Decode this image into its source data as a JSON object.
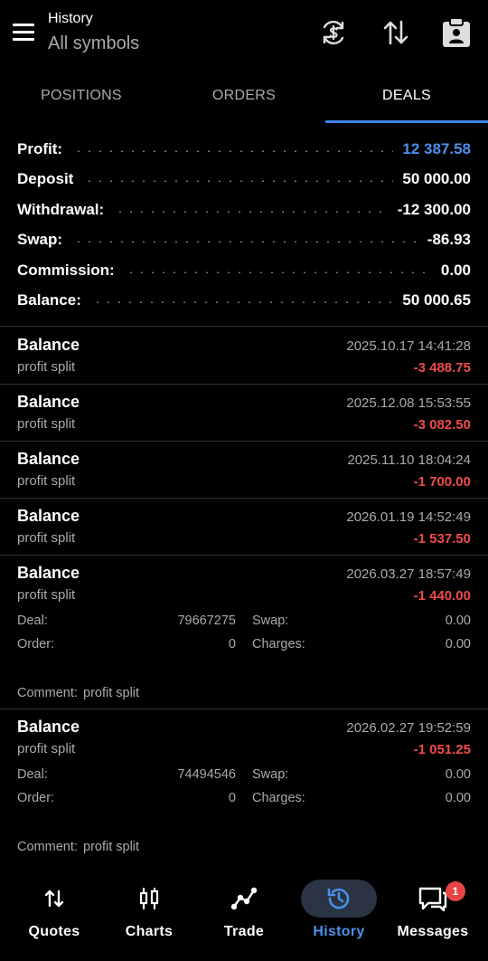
{
  "header": {
    "title": "History",
    "subtitle": "All symbols",
    "icons": [
      "menu-icon",
      "sync-currency-icon",
      "sort-icon",
      "clipboard-user-icon"
    ]
  },
  "tabs": [
    {
      "label": "POSITIONS",
      "active": false
    },
    {
      "label": "ORDERS",
      "active": false
    },
    {
      "label": "DEALS",
      "active": true
    }
  ],
  "summary": [
    {
      "label": "Profit:",
      "value": "12 387.58",
      "accent": "#4a90ea"
    },
    {
      "label": "Deposit",
      "value": "50 000.00"
    },
    {
      "label": "Withdrawal:",
      "value": "-12 300.00"
    },
    {
      "label": "Swap:",
      "value": "-86.93"
    },
    {
      "label": "Commission:",
      "value": "0.00"
    },
    {
      "label": "Balance:",
      "value": "50 000.65"
    }
  ],
  "deals": [
    {
      "name": "Balance",
      "comment_short": "profit split",
      "time": "2025.10.17 14:41:28",
      "amount": "-3 488.75"
    },
    {
      "name": "Balance",
      "comment_short": "profit split",
      "time": "2025.12.08 15:53:55",
      "amount": "-3 082.50"
    },
    {
      "name": "Balance",
      "comment_short": "profit split",
      "time": "2025.11.10 18:04:24",
      "amount": "-1 700.00"
    },
    {
      "name": "Balance",
      "comment_short": "profit split",
      "time": "2026.01.19 14:52:49",
      "amount": "-1 537.50"
    },
    {
      "name": "Balance",
      "comment_short": "profit split",
      "time": "2026.03.27 18:57:49",
      "amount": "-1 440.00",
      "details": {
        "deal_label": "Deal:",
        "deal": "79667275",
        "order_label": "Order:",
        "order": "0",
        "swap_label": "Swap:",
        "swap": "0.00",
        "charges_label": "Charges:",
        "charges": "0.00",
        "comment_label": "Comment:",
        "comment": "profit split"
      }
    },
    {
      "name": "Balance",
      "comment_short": "profit split",
      "time": "2026.02.27 19:52:59",
      "amount": "-1 051.25",
      "details": {
        "deal_label": "Deal:",
        "deal": "74494546",
        "order_label": "Order:",
        "order": "0",
        "swap_label": "Swap:",
        "swap": "0.00",
        "charges_label": "Charges:",
        "charges": "0.00",
        "comment_label": "Comment:",
        "comment": "profit split"
      }
    }
  ],
  "bottom_nav": [
    {
      "label": "Quotes",
      "icon": "quotes-icon",
      "active": false
    },
    {
      "label": "Charts",
      "icon": "charts-icon",
      "active": false
    },
    {
      "label": "Trade",
      "icon": "trade-icon",
      "active": false
    },
    {
      "label": "History",
      "icon": "history-icon",
      "active": true
    },
    {
      "label": "Messages",
      "icon": "messages-icon",
      "active": false,
      "badge": "1"
    }
  ],
  "colors": {
    "accent": "#4a90ea",
    "negative": "#ef4b4b",
    "badge": "#e94444"
  }
}
